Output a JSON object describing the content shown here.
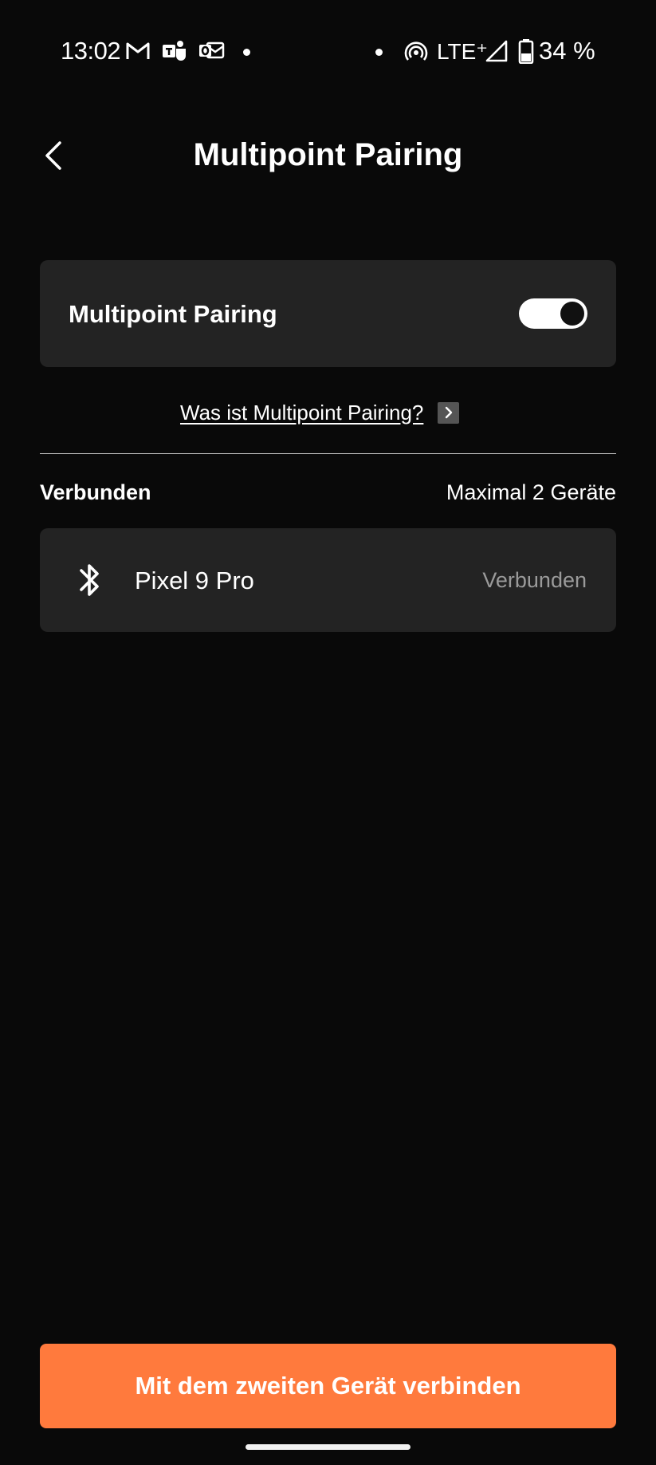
{
  "status_bar": {
    "time": "13:02",
    "network": "LTE⁺",
    "battery_percent": "34 %",
    "icons": [
      "gmail-icon",
      "teams-icon",
      "outlook-icon",
      "notification-dot-icon",
      "hotspot-icon",
      "signal-icon",
      "battery-icon"
    ]
  },
  "header": {
    "title": "Multipoint Pairing",
    "back_icon": "chevron-left-icon"
  },
  "multipoint_card": {
    "label": "Multipoint Pairing",
    "toggle_on": true
  },
  "info_link": {
    "text": "Was ist Multipoint Pairing?",
    "icon": "chevron-right-icon"
  },
  "connected_section": {
    "title": "Verbunden",
    "limit_text": "Maximal 2 Geräte",
    "devices": [
      {
        "name": "Pixel 9 Pro",
        "status": "Verbunden",
        "icon": "bluetooth-icon"
      }
    ]
  },
  "actions": {
    "connect_second_label": "Mit dem zweiten Gerät verbinden"
  },
  "colors": {
    "background": "#090909",
    "card": "#232323",
    "accent": "#ff7a3d",
    "muted_text": "#9a9a9a"
  }
}
